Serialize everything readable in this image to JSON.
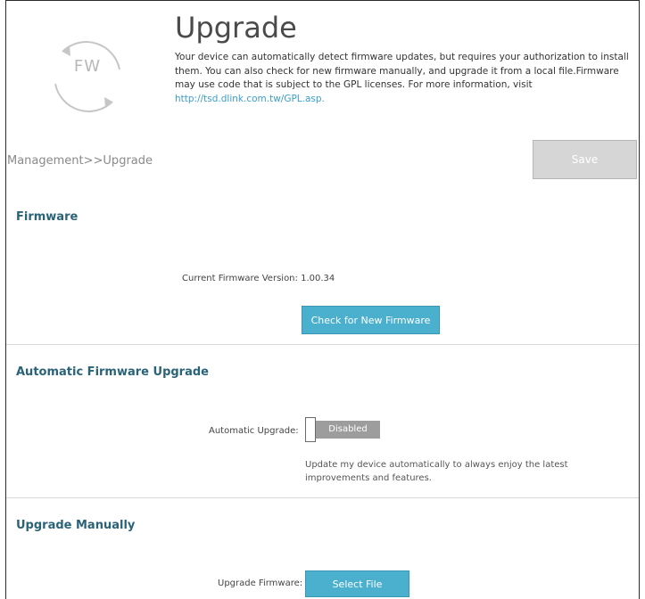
{
  "header": {
    "logo_text": "FW",
    "title": "Upgrade",
    "description": "Your device can automatically detect firmware updates, but requires your authorization to install them. You can also check for new firmware manually, and upgrade it from a local file.Firmware may use code that is subject to the GPL licenses. For more information, visit",
    "gpl_link": "http://tsd.dlink.com.tw/GPL.asp."
  },
  "breadcrumb": "Management>>Upgrade",
  "toolbar": {
    "save_label": "Save"
  },
  "firmware": {
    "section_title": "Firmware",
    "current_version_label": "Current Firmware Version:",
    "current_version_value": "1.00.34",
    "check_button_label": "Check for New Firmware"
  },
  "auto_upgrade": {
    "section_title": "Automatic Firmware Upgrade",
    "label": "Automatic Upgrade:",
    "toggle_state": "Disabled",
    "hint": "Update my device automatically to always enjoy the latest improvements and features."
  },
  "manual_upgrade": {
    "section_title": "Upgrade Manually",
    "label": "Upgrade Firmware:",
    "select_button_label": "Select File"
  },
  "colors": {
    "accent_blue": "#4bb0ce",
    "section_title": "#2a6378",
    "save_disabled": "#d6d6d6",
    "toggle_off": "#9d9d9d"
  }
}
